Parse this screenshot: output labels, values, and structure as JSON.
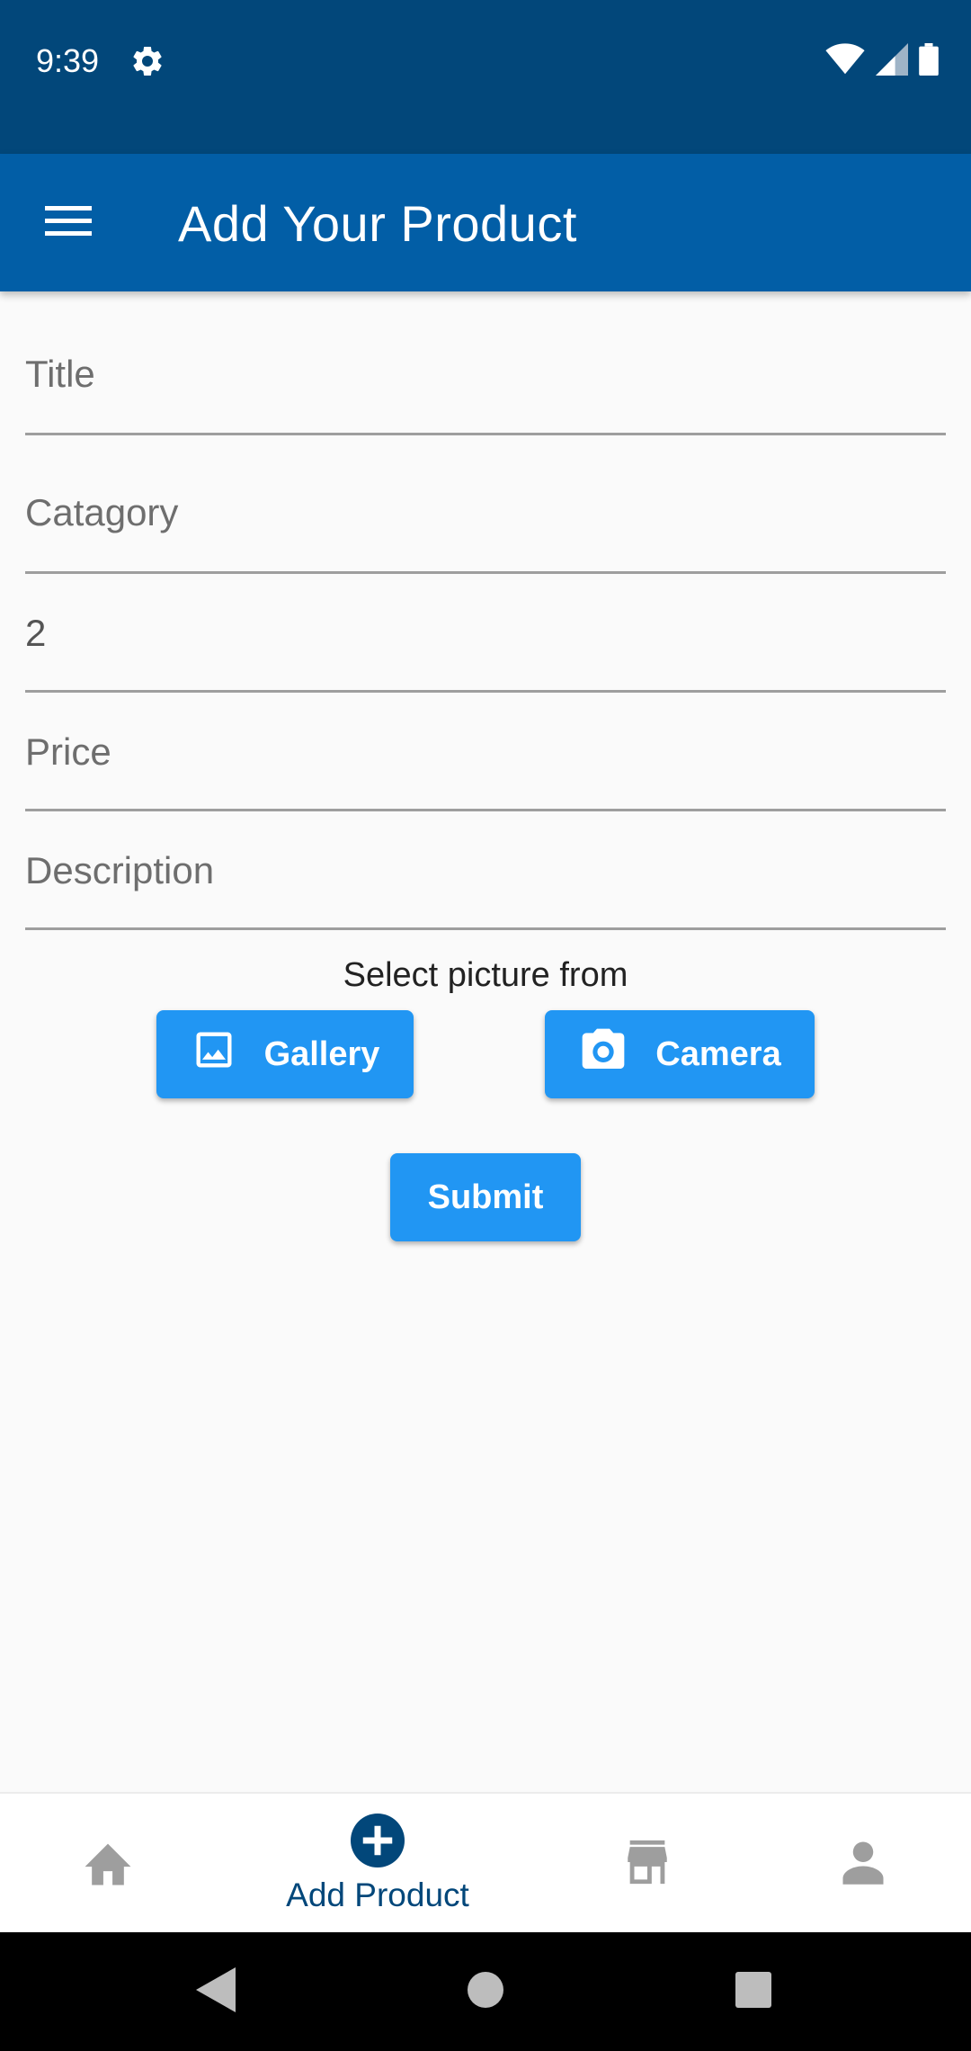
{
  "status_bar": {
    "time": "9:39",
    "icons": [
      "gear-icon",
      "wifi-icon",
      "cell-signal-icon",
      "battery-icon"
    ]
  },
  "app_bar": {
    "title": "Add Your Product",
    "menu_icon": "hamburger-menu-icon"
  },
  "form": {
    "fields": [
      {
        "label": "Title",
        "value": ""
      },
      {
        "label": "Catagory",
        "value": ""
      },
      {
        "label": "",
        "value": "2"
      },
      {
        "label": "Price",
        "value": ""
      },
      {
        "label": "Description",
        "value": ""
      }
    ],
    "select_caption": "Select picture from",
    "gallery_label": "Gallery",
    "camera_label": "Camera",
    "submit_label": "Submit"
  },
  "bottom_nav": {
    "items": [
      {
        "icon": "home-icon",
        "label": ""
      },
      {
        "icon": "add-circle-icon",
        "label": "Add Product"
      },
      {
        "icon": "store-icon",
        "label": ""
      },
      {
        "icon": "person-icon",
        "label": ""
      }
    ],
    "active_index": 1
  },
  "colors": {
    "status_bar": "#02477a",
    "app_bar": "#025ea6",
    "button": "#2196f3",
    "active_nav": "#02477a",
    "inactive_nav": "#9e9e9e"
  }
}
